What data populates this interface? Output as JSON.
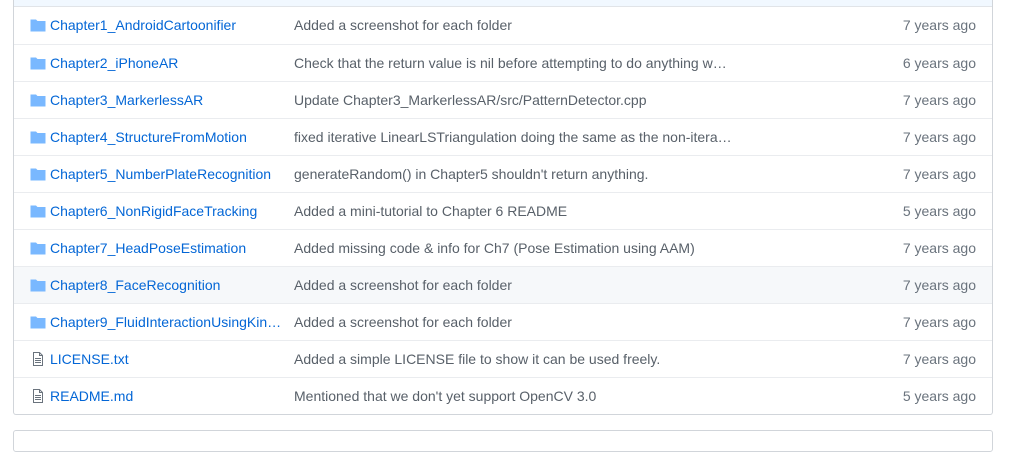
{
  "files": [
    {
      "type": "folder",
      "icon": "folder-icon",
      "name": "Chapter1_AndroidCartoonifier",
      "message": "Added a screenshot for each folder",
      "age": "7 years ago"
    },
    {
      "type": "folder",
      "icon": "folder-icon",
      "name": "Chapter2_iPhoneAR",
      "message": "Check that the return value is nil before attempting to do anything w…",
      "age": "6 years ago"
    },
    {
      "type": "folder",
      "icon": "folder-icon",
      "name": "Chapter3_MarkerlessAR",
      "message": "Update Chapter3_MarkerlessAR/src/PatternDetector.cpp",
      "age": "7 years ago"
    },
    {
      "type": "folder",
      "icon": "folder-icon",
      "name": "Chapter4_StructureFromMotion",
      "message": "fixed iterative LinearLSTriangulation doing the same as the non-itera…",
      "age": "7 years ago"
    },
    {
      "type": "folder",
      "icon": "folder-icon",
      "name": "Chapter5_NumberPlateRecognition",
      "message": "generateRandom() in Chapter5 shouldn't return anything.",
      "age": "7 years ago"
    },
    {
      "type": "folder",
      "icon": "folder-icon",
      "name": "Chapter6_NonRigidFaceTracking",
      "message": "Added a mini-tutorial to Chapter 6 README",
      "age": "5 years ago"
    },
    {
      "type": "folder",
      "icon": "folder-icon",
      "name": "Chapter7_HeadPoseEstimation",
      "message": "Added missing code & info for Ch7 (Pose Estimation using AAM)",
      "age": "7 years ago"
    },
    {
      "type": "folder",
      "icon": "folder-icon",
      "name": "Chapter8_FaceRecognition",
      "message": "Added a screenshot for each folder",
      "age": "7 years ago"
    },
    {
      "type": "folder",
      "icon": "folder-icon",
      "name": "Chapter9_FluidInteractionUsingKine…",
      "message": "Added a screenshot for each folder",
      "age": "7 years ago"
    },
    {
      "type": "file",
      "icon": "file-icon",
      "name": "LICENSE.txt",
      "message": "Added a simple LICENSE file to show it can be used freely.",
      "age": "7 years ago"
    },
    {
      "type": "file",
      "icon": "file-icon",
      "name": "README.md",
      "message": "Mentioned that we don't yet support OpenCV 3.0",
      "age": "5 years ago"
    }
  ],
  "colors": {
    "link": "#0366d6",
    "folder_icon": "#79b8ff",
    "file_icon": "#6a737d",
    "hover_row": "#f6f8fa"
  }
}
